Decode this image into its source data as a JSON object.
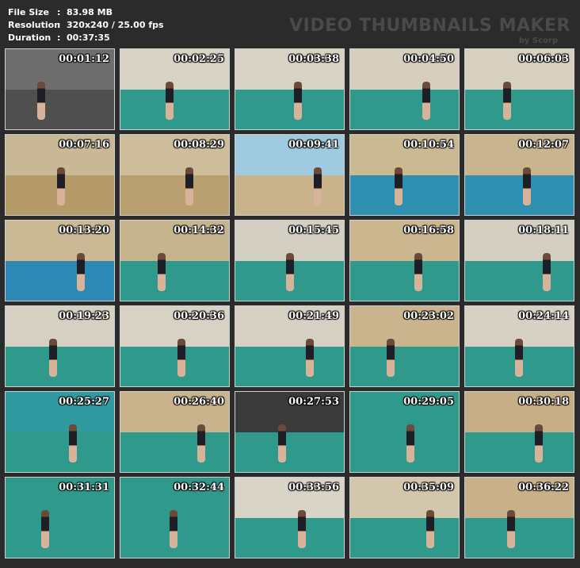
{
  "info": {
    "file_size_label": "File Size",
    "file_size_value": "83.98 MB",
    "resolution_label": "Resolution",
    "resolution_value": "320x240 / 25.00 fps",
    "duration_label": "Duration",
    "duration_value": "00:37:35"
  },
  "watermark": {
    "title": "VIDEO THUMBNAILS MAKER",
    "subtitle": "by Scorp"
  },
  "thumbnails": [
    {
      "time": "00:01:12",
      "wall": "#6e6e6e",
      "floor": "#4f4f4f"
    },
    {
      "time": "00:02:25",
      "wall": "#d9d3c6",
      "floor": "#2f9a8c"
    },
    {
      "time": "00:03:38",
      "wall": "#d8d2c4",
      "floor": "#2f9a8c"
    },
    {
      "time": "00:04:50",
      "wall": "#d6cfbf",
      "floor": "#2f9a8c"
    },
    {
      "time": "00:06:03",
      "wall": "#d7d0c1",
      "floor": "#2f9a8c"
    },
    {
      "time": "00:07:16",
      "wall": "#c9b896",
      "floor": "#b59a6a"
    },
    {
      "time": "00:08:29",
      "wall": "#cdbd9a",
      "floor": "#b9a070"
    },
    {
      "time": "00:09:41",
      "wall": "#9fc9de",
      "floor": "#c9b38a"
    },
    {
      "time": "00:10:54",
      "wall": "#cbb993",
      "floor": "#2f8fb0"
    },
    {
      "time": "00:12:07",
      "wall": "#c8b590",
      "floor": "#2f8fb0"
    },
    {
      "time": "00:13:20",
      "wall": "#cbb995",
      "floor": "#2d88b5"
    },
    {
      "time": "00:14:32",
      "wall": "#c6b48f",
      "floor": "#2f9a8c"
    },
    {
      "time": "00:15:45",
      "wall": "#d4cfc3",
      "floor": "#2f9a8c"
    },
    {
      "time": "00:16:58",
      "wall": "#cbb68f",
      "floor": "#2f9a8c"
    },
    {
      "time": "00:18:11",
      "wall": "#d5cfc2",
      "floor": "#2f9a8c"
    },
    {
      "time": "00:19:23",
      "wall": "#d6d0c2",
      "floor": "#2f9a8c"
    },
    {
      "time": "00:20:36",
      "wall": "#d8d2c5",
      "floor": "#2f9a8c"
    },
    {
      "time": "00:21:49",
      "wall": "#d6d0c2",
      "floor": "#2f9a8c"
    },
    {
      "time": "00:23:02",
      "wall": "#c9b48e",
      "floor": "#2f9a8c"
    },
    {
      "time": "00:24:14",
      "wall": "#d7d1c4",
      "floor": "#2f9a8c"
    },
    {
      "time": "00:25:27",
      "wall": "#2f9aa0",
      "floor": "#2f9a8c"
    },
    {
      "time": "00:26:40",
      "wall": "#c8b38c",
      "floor": "#2f9a8c"
    },
    {
      "time": "00:27:53",
      "wall": "#3a3a3a",
      "floor": "#2f9a8c"
    },
    {
      "time": "00:29:05",
      "wall": "#2f9a8c",
      "floor": "#2f9a8c"
    },
    {
      "time": "00:30:18",
      "wall": "#c6ae86",
      "floor": "#2f9a8c"
    },
    {
      "time": "00:31:31",
      "wall": "#2f9a8c",
      "floor": "#2f9a8c"
    },
    {
      "time": "00:32:44",
      "wall": "#2f9a8c",
      "floor": "#2f9a8c"
    },
    {
      "time": "00:33:56",
      "wall": "#d9d4c8",
      "floor": "#2f9a8c"
    },
    {
      "time": "00:35:09",
      "wall": "#d2c6ad",
      "floor": "#2f9a8c"
    },
    {
      "time": "00:36:22",
      "wall": "#c7b08a",
      "floor": "#2f9a8c"
    }
  ]
}
